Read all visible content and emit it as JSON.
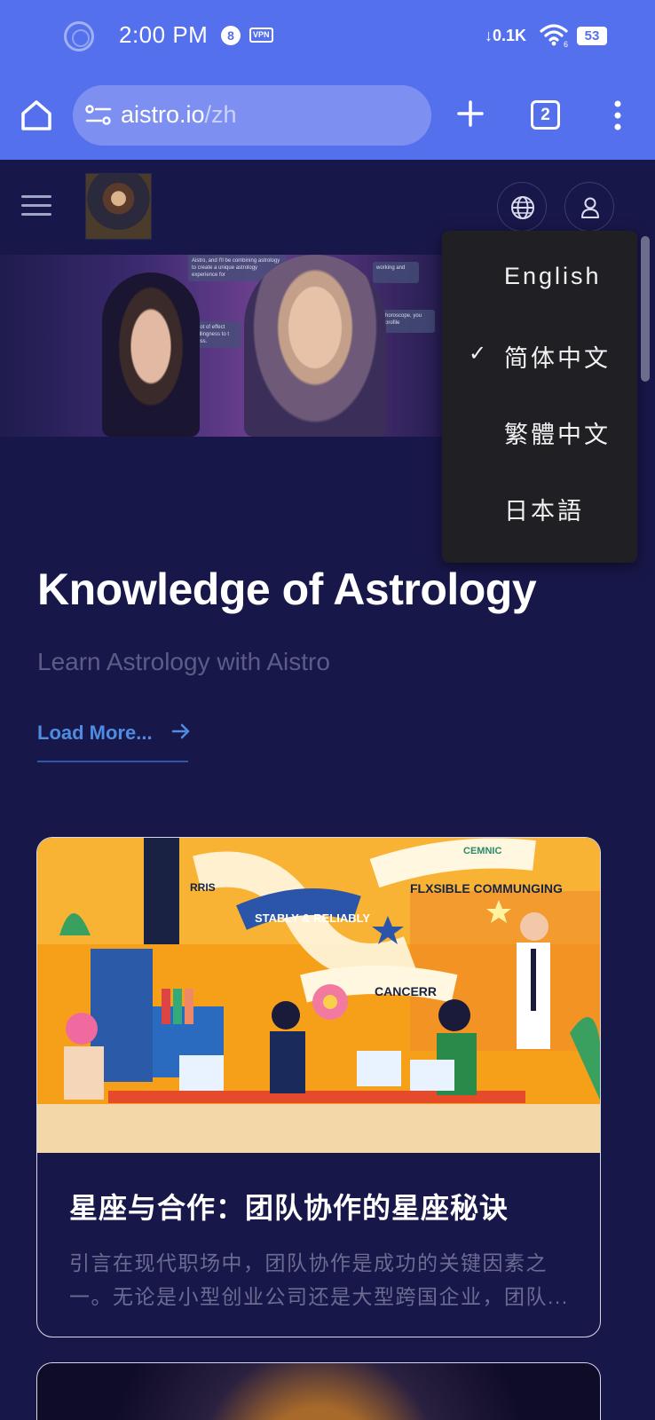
{
  "status_bar": {
    "time": "2:00 PM",
    "notification_count": "8",
    "vpn_label": "VPN",
    "network_speed": "0.1K",
    "wifi_badge": "6",
    "battery": "53"
  },
  "browser": {
    "url_domain": "aistro.io",
    "url_path": "/zh",
    "tab_count": "2"
  },
  "language_menu": {
    "items": [
      {
        "label": "English",
        "selected": false
      },
      {
        "label": "简体中文",
        "selected": true
      },
      {
        "label": "繁體中文",
        "selected": false
      },
      {
        "label": "日本語",
        "selected": false
      }
    ],
    "check_mark": "✓"
  },
  "hero": {
    "panel_texts": [
      "Aistro, and I'll be combining astrology to create a unique astrology experience for",
      "working and",
      "a lot of effect willingness to t ness.",
      "horoscope, you profile"
    ]
  },
  "knowledge": {
    "title": "Knowledge of Astrology",
    "subtitle": "Learn Astrology with Aistro",
    "load_more": "Load More..."
  },
  "articles": [
    {
      "title": "星座与合作：团队协作的星座秘诀",
      "excerpt": "引言在现代职场中，团队协作是成功的关键因素之一。无论是小型创业公司还是大型跨国企业，团队...",
      "image_texts": [
        "STABLY & RELIABLY",
        "FLXSIBLE COMMUNGING",
        "CANCERR",
        "RRIS",
        "CEMNIC"
      ]
    }
  ],
  "colors": {
    "status_bar_bg": "#5470ec",
    "page_bg": "#18174a",
    "accent_link": "#4f8be0",
    "menu_bg": "#1f1f24"
  }
}
